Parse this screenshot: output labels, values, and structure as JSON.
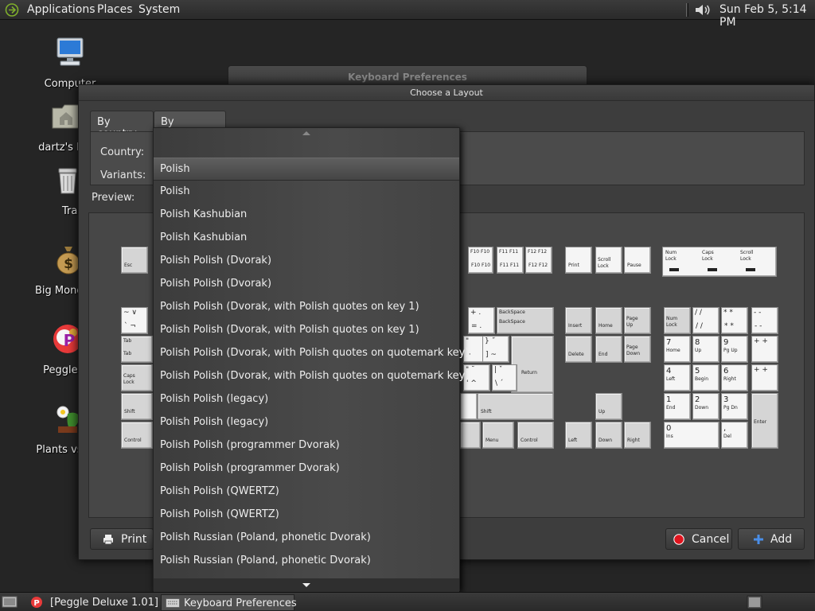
{
  "top_panel": {
    "menus": [
      "Applications",
      "Places",
      "System"
    ],
    "clock": "Sun Feb  5,  5:14 PM"
  },
  "desktop": {
    "icons": [
      {
        "label": "Computer"
      },
      {
        "label": "dartz's H"
      },
      {
        "label": "Tras"
      },
      {
        "label": "Big Money"
      },
      {
        "label": "Peggle D"
      },
      {
        "label": "Plants vs Z"
      }
    ]
  },
  "background_window": {
    "title": "Keyboard Preferences"
  },
  "dialog": {
    "title": "Choose a Layout",
    "tabs": [
      "By country",
      "By language"
    ],
    "country_label": "Country:",
    "variants_label": "Variants:",
    "preview_label": "Preview:",
    "print_label": "Print",
    "cancel_label": "Cancel",
    "add_label": "Add"
  },
  "variants_popup": {
    "selected_index": 0,
    "items": [
      "Polish",
      "Polish",
      "Polish Kashubian",
      "Polish Kashubian",
      "Polish Polish (Dvorak)",
      "Polish Polish (Dvorak)",
      "Polish Polish (Dvorak, with Polish quotes on key 1)",
      "Polish Polish (Dvorak, with Polish quotes on key 1)",
      "Polish Polish (Dvorak, with Polish quotes on quotemark key)",
      "Polish Polish (Dvorak, with Polish quotes on quotemark key)",
      "Polish Polish (legacy)",
      "Polish Polish (legacy)",
      "Polish Polish (programmer Dvorak)",
      "Polish Polish (programmer Dvorak)",
      "Polish Polish (QWERTZ)",
      "Polish Polish (QWERTZ)",
      "Polish Russian (Poland, phonetic Dvorak)",
      "Polish Russian (Poland, phonetic Dvorak)"
    ]
  },
  "keyboard": {
    "esc": "Esc",
    "fkeys": [
      {
        "top": "F10 F10",
        "bot": "F10 F10"
      },
      {
        "top": "F11  F11",
        "bot": "F11  F11"
      },
      {
        "top": "F12  F12",
        "bot": "F12  F12"
      }
    ],
    "print": "Print",
    "scroll": [
      "Scroll",
      "Lock"
    ],
    "pause": "Pause",
    "indicators": [
      [
        "Num",
        "Lock"
      ],
      [
        "Caps",
        "Lock"
      ],
      [
        "Scroll",
        "Lock"
      ]
    ],
    "tilde": {
      "top": "~  ∨",
      "bot": "`  ¬"
    },
    "plus": {
      "top": "+  .",
      "bot": "=  ."
    },
    "backspace": [
      "BackSpace",
      "BackSpace"
    ],
    "tab": [
      "Tab",
      "Tab"
    ],
    "brace": {
      "top": "}  ˝",
      "bot": "]  ~"
    },
    "quote_small": {
      "top": "\"",
      "bot": "··"
    },
    "return": "Return",
    "caps": [
      "Caps",
      "Lock"
    ],
    "dquote": {
      "top": "\"  ˘",
      "bot": "'  ^"
    },
    "pipe": {
      "top": "|  ˇ",
      "bot": "\\  ´"
    },
    "shift_l": "Shift",
    "shift_r": "Shift",
    "control_l": "Control",
    "menu": "Menu",
    "control_r": "Control",
    "nav": {
      "insert": "Insert",
      "home": "Home",
      "page_up": [
        "Page",
        "Up"
      ],
      "delete": "Delete",
      "end": "End",
      "page_down": [
        "Page",
        "Down"
      ],
      "up": "Up",
      "left": "Left",
      "down": "Down",
      "right": "Right"
    },
    "numpad": {
      "num_lock": [
        "Num",
        "Lock"
      ],
      "div": {
        "top": "/  /",
        "bot": "/  /"
      },
      "mul": {
        "top": "*  *",
        "bot": "*  *"
      },
      "minus": {
        "top": "-  -",
        "bot": "-  -"
      },
      "plus": "+  +",
      "plus2": "+  +",
      "enter": "Enter",
      "n7": {
        "num": "7",
        "sub": "Home"
      },
      "n8": {
        "num": "8",
        "sub": "Up"
      },
      "n9": {
        "num": "9",
        "sub": "Pg Up"
      },
      "n4": {
        "num": "4",
        "sub": "Left"
      },
      "n5": {
        "num": "5",
        "sub": "Begin"
      },
      "n6": {
        "num": "6",
        "sub": "Right"
      },
      "n1": {
        "num": "1",
        "sub": "End"
      },
      "n2": {
        "num": "2",
        "sub": "Down"
      },
      "n3": {
        "num": "3",
        "sub": "Pg Dn"
      },
      "n0": {
        "num": "0",
        "sub": "Ins"
      },
      "dot": {
        "num": ",",
        "sub": "Del"
      }
    }
  },
  "taskbar": {
    "tasks": [
      "[Peggle Deluxe 1.01]",
      "Keyboard Preferences"
    ]
  },
  "colors": {
    "cancel_red": "#e0141e",
    "add_blue": "#4a8ee8"
  }
}
